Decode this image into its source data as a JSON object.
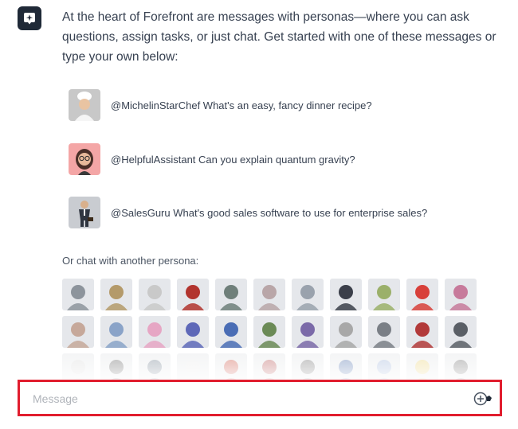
{
  "intro": {
    "text": "At the heart of Forefront are messages with personas—where you can ask questions, assign tasks, or just chat. Get started with one of these messages or type your own below:"
  },
  "suggestions": [
    {
      "text": "@MichelinStarChef What's an easy, fancy dinner recipe?",
      "avatar_color": "#c8c8c8"
    },
    {
      "text": "@HelpfulAssistant Can you explain quantum gravity?",
      "avatar_color": "#f4a6a6"
    },
    {
      "text": "@SalesGuru What's good sales software to use for enterprise sales?",
      "avatar_color": "#c9ccd1"
    }
  ],
  "persona_section": {
    "label": "Or chat with another persona:"
  },
  "personas": [
    "#8d949c",
    "#b49a6a",
    "#c9c9c9",
    "#b2342e",
    "#6f7f7a",
    "#b9a6a8",
    "#9aa2ad",
    "#3b3f4a",
    "#9bb06a",
    "#d8403a",
    "#c77a9b",
    "#c6a89a",
    "#8aa3c8",
    "#e6a6c4",
    "#5e68b8",
    "#4a6db5",
    "#6b8a56",
    "#7b6aa8",
    "#a8a8a8",
    "#7a7f86",
    "#b23a3a",
    "#5a5f66",
    "#d8d8d8",
    "#5a5a5a",
    "#6a7a8a",
    "#e8e8e8",
    "#c84a3a",
    "#b04a4a",
    "#6a6a6a",
    "#4a6aa8",
    "#9ab0d8",
    "#e8d070",
    "#6a6a6a"
  ],
  "composer": {
    "placeholder": "Message",
    "value": ""
  },
  "colors": {
    "accent_border": "#e11d2e",
    "text": "#374151",
    "bot_icon_bg": "#1f2937"
  }
}
